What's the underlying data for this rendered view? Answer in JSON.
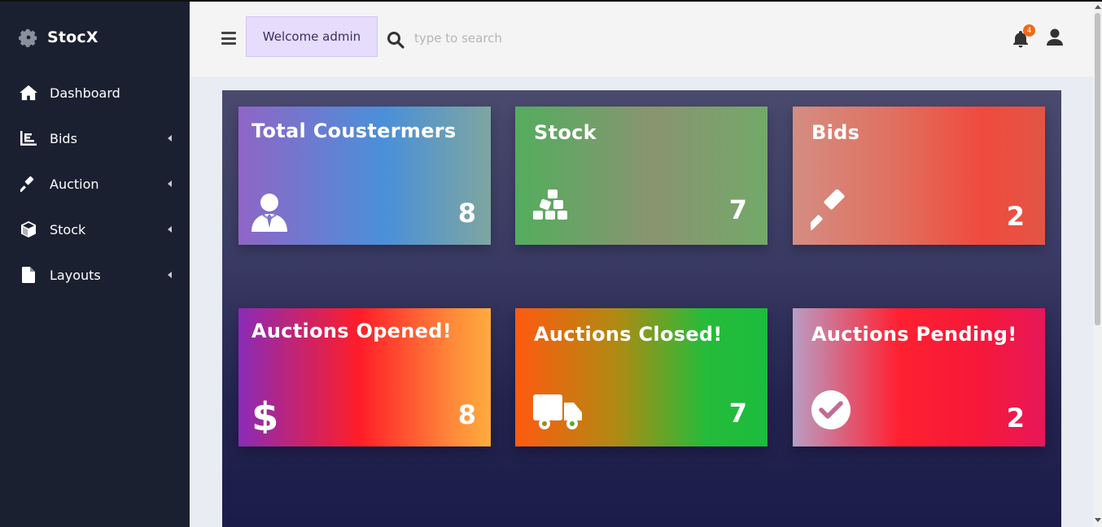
{
  "brand": {
    "name": "StocX",
    "logo_icon": "gear-icon"
  },
  "sidebar": {
    "items": [
      {
        "label": "Dashboard",
        "icon": "home-icon"
      },
      {
        "label": "Bids",
        "icon": "chart-icon"
      },
      {
        "label": "Auction",
        "icon": "gavel-icon"
      },
      {
        "label": "Stock",
        "icon": "box-icon"
      },
      {
        "label": "Layouts",
        "icon": "file-icon"
      }
    ]
  },
  "header": {
    "welcome": "Welcome admin",
    "search": {
      "placeholder": "type to search",
      "value": ""
    },
    "notifications": {
      "count": "4"
    }
  },
  "cards": [
    {
      "title": "Total Coustermers",
      "value": "8",
      "icon": "user-tie-icon"
    },
    {
      "title": "Stock",
      "value": "7",
      "icon": "cubes-icon"
    },
    {
      "title": "Bids",
      "value": "2",
      "icon": "gavel-icon"
    },
    {
      "title": "Auctions Opened!",
      "value": "8",
      "icon": "dollar-icon"
    },
    {
      "title": "Auctions Closed!",
      "value": "7",
      "icon": "truck-icon"
    },
    {
      "title": "Auctions Pending!",
      "value": "2",
      "icon": "check-circle-icon"
    }
  ],
  "colors": {
    "sidebar_bg": "#1b2030",
    "welcome_bg": "#e6dcfb",
    "badge": "#f06a1a",
    "content_bg_top": "#4a4a6e",
    "content_bg_bottom": "#1c1c4a"
  }
}
